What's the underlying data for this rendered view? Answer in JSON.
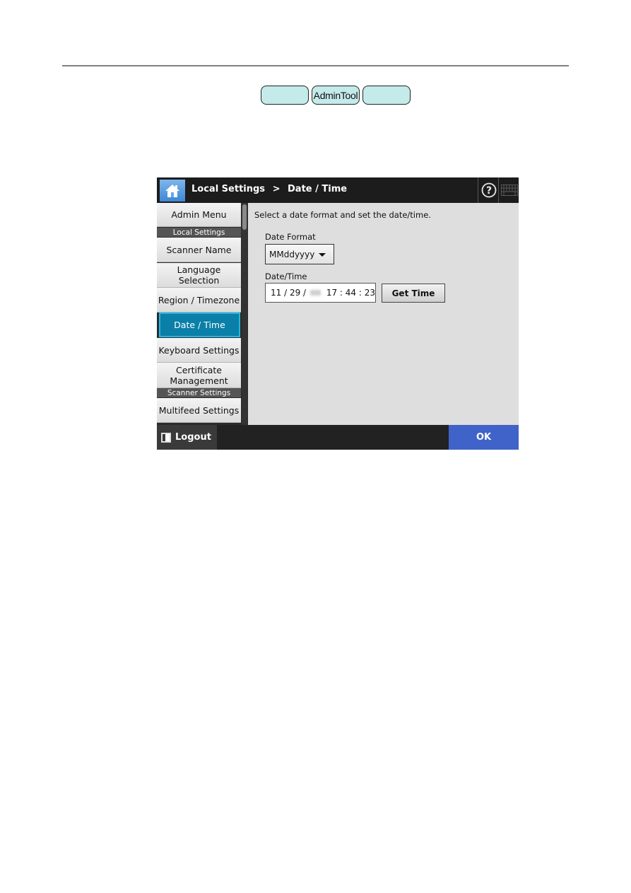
{
  "page": {
    "pill_buttons": [
      "",
      "AdminTool",
      ""
    ]
  },
  "screen": {
    "breadcrumb": {
      "parent": "Local Settings",
      "separator": ">",
      "current": "Date / Time"
    },
    "icons": {
      "home": "home-icon",
      "help": "question-circle-icon",
      "keyboard": "keyboard-icon",
      "logout": "logout-icon"
    },
    "sidebar": {
      "items": [
        {
          "label": "Admin Menu"
        },
        {
          "header": "Local Settings"
        },
        {
          "label": "Scanner Name"
        },
        {
          "label": "Language Selection"
        },
        {
          "label": "Region / Timezone"
        },
        {
          "label": "Date / Time",
          "active": true
        },
        {
          "label": "Keyboard Settings"
        },
        {
          "label": "Certificate Management"
        },
        {
          "header": "Scanner Settings"
        },
        {
          "label": "Multifeed Settings"
        }
      ]
    },
    "content": {
      "instruction": "Select a date format and set the date/time.",
      "date_format_label": "Date Format",
      "date_format_value": "MMddyyyy",
      "datetime_label": "Date/Time",
      "date_month": "11",
      "date_day": "29",
      "date_year": "(obscured)",
      "time": "17 : 44 : 23",
      "get_time_label": "Get Time"
    },
    "bottom": {
      "logout_label": "Logout",
      "ok_label": "OK"
    },
    "colors": {
      "active_item": "#0a7fa8",
      "ok_button": "#3f63c8",
      "topbar": "#1c1c1c",
      "pill": "#c4eaea"
    }
  }
}
